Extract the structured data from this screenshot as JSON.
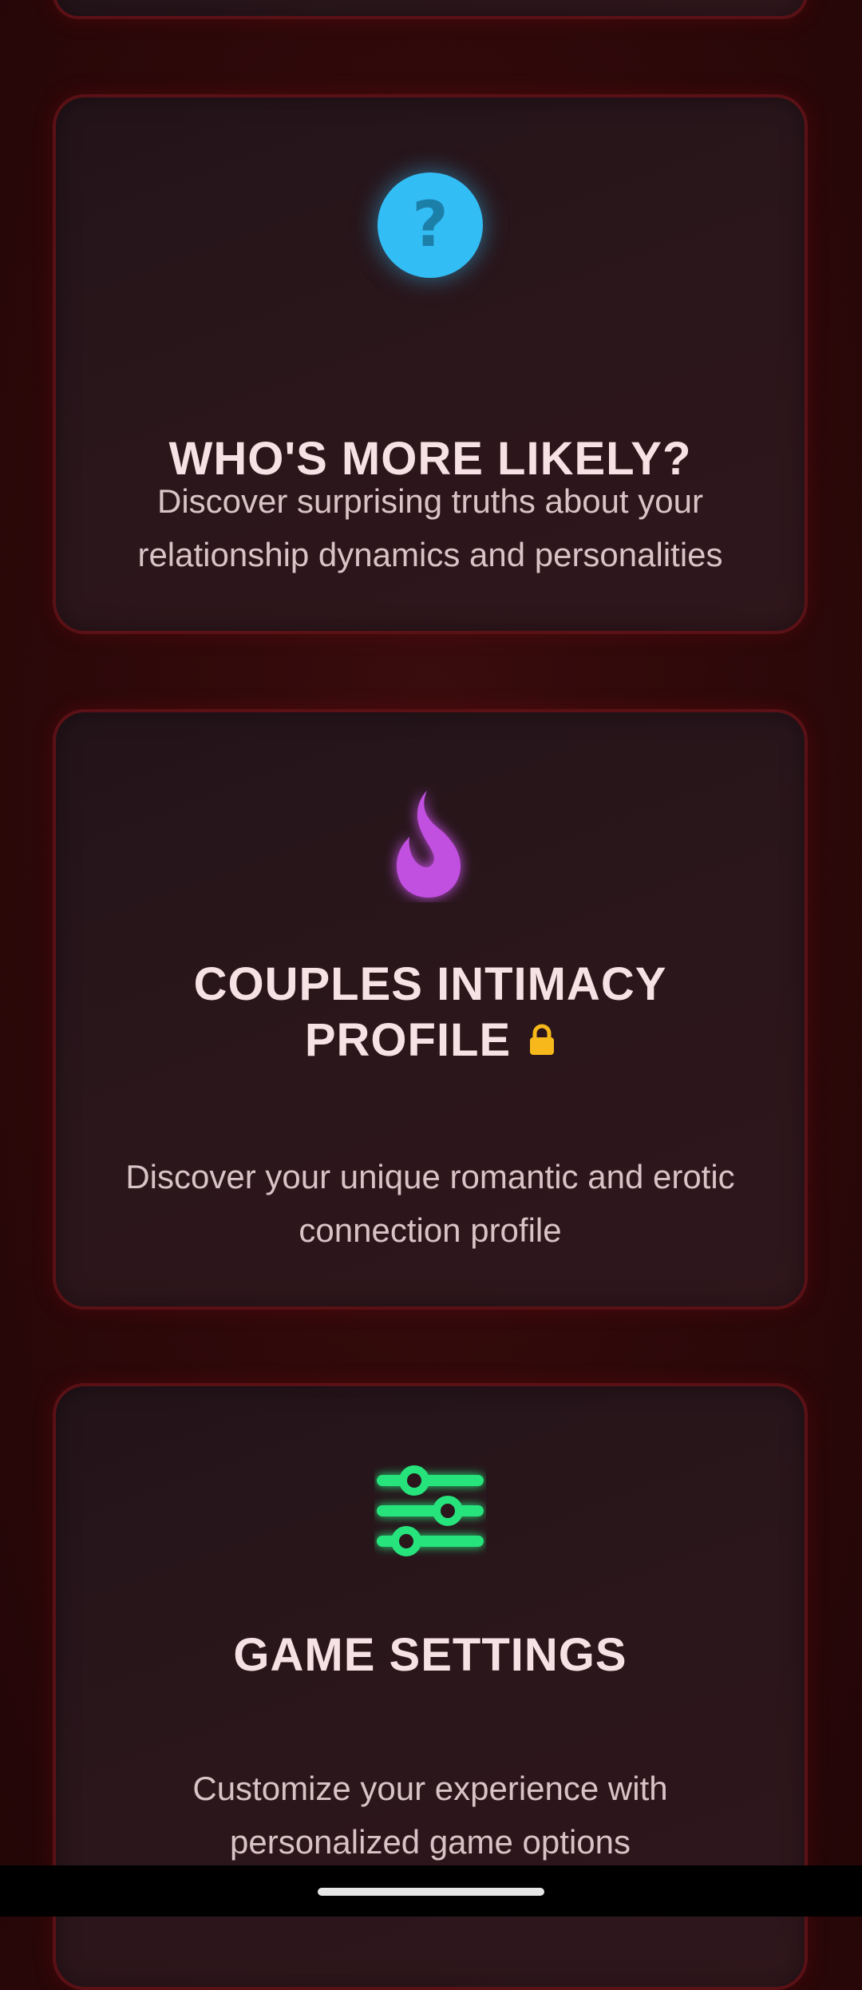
{
  "cards": [
    {
      "title": "WHO'S MORE LIKELY?",
      "description": "Discover surprising truths about your relationship dynamics and personalities",
      "icon": "question-icon",
      "icon_glyph": "?",
      "accent": "#33bdf5"
    },
    {
      "title": "COUPLES INTIMACY PROFILE",
      "description": "Discover your unique romantic and erotic connection profile",
      "icon": "flame-icon",
      "accent": "#c14fe0",
      "locked": true,
      "lock_color": "#f7b81c"
    },
    {
      "title": "GAME SETTINGS",
      "description": "Customize your experience with personalized game options",
      "icon": "sliders-icon",
      "accent": "#27e37c"
    }
  ],
  "colors": {
    "background": "#2c0809",
    "card_border": "#5a1116",
    "title_text": "#f6e2e4",
    "desc_text": "#d8c3c6"
  }
}
